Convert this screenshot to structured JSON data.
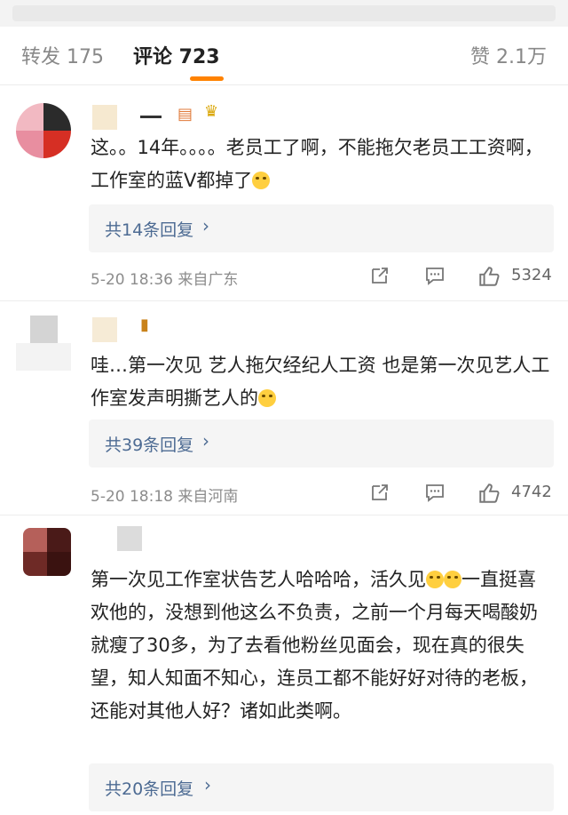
{
  "tabs": {
    "repost": "转发 175",
    "comment": "评论 723",
    "like": "赞 2.1万"
  },
  "colors": {
    "accent": "#ff8200",
    "link": "#4d6b93"
  },
  "comments": [
    {
      "text": "这。。14年。。。。老员工了啊，不能拖欠老员工工资啊，工作室的蓝V都掉了",
      "emoji": "laugh-cry-emoji",
      "replies": "共14条回复",
      "meta": "5-20 18:36 来自广东",
      "likes": "5324"
    },
    {
      "text": "哇…第一次见 艺人拖欠经纪人工资 也是第一次见艺人工作室发声明撕艺人的",
      "emoji": "scream-emoji",
      "replies": "共39条回复",
      "meta": "5-20 18:18 来自河南",
      "likes": "4742"
    },
    {
      "text_part1": "第一次见工作室状告艺人哈哈哈，活久见",
      "text_part2": "一直挺喜欢他的，没想到他这么不负责，之前一个月每天喝酸奶就瘦了30多，为了去看他粉丝见面会，现在真的很失望，知人知面不知心，连员工都不能好好对待的老板，还能对其他人好？诸如此类啊。",
      "emoji": "laugh-cry-emoji",
      "replies": "共20条回复"
    }
  ]
}
